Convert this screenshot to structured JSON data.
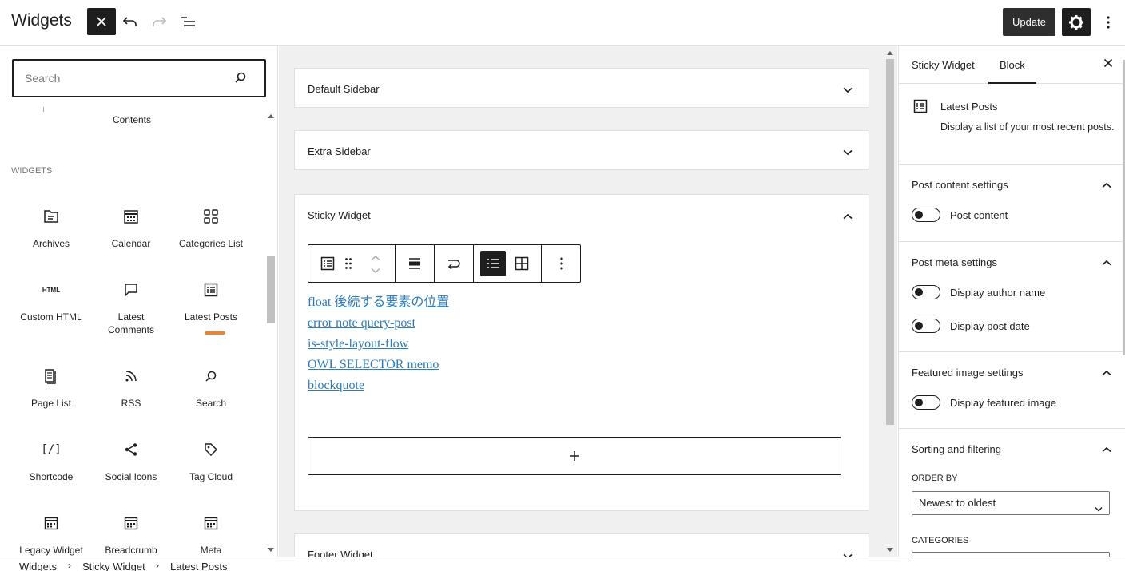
{
  "header": {
    "title": "Widgets",
    "update_label": "Update"
  },
  "inserter": {
    "search_placeholder": "Search",
    "contents_label": "Contents",
    "section_label": "WIDGETS",
    "blocks": [
      {
        "label": "Archives",
        "icon": "archive-icon"
      },
      {
        "label": "Calendar",
        "icon": "calendar-icon"
      },
      {
        "label": "Categories List",
        "icon": "categories-icon"
      },
      {
        "label": "Custom HTML",
        "icon": "html-icon",
        "icon_text": "HTML"
      },
      {
        "label": "Latest Comments",
        "icon": "comment-icon"
      },
      {
        "label": "Latest Posts",
        "icon": "post-list-icon"
      },
      {
        "label": "Page List",
        "icon": "pages-icon"
      },
      {
        "label": "RSS",
        "icon": "rss-icon"
      },
      {
        "label": "Search",
        "icon": "search-icon"
      },
      {
        "label": "Shortcode",
        "icon": "shortcode-icon",
        "icon_text": "[/]"
      },
      {
        "label": "Social Icons",
        "icon": "share-icon"
      },
      {
        "label": "Tag Cloud",
        "icon": "tag-icon"
      },
      {
        "label": "Legacy Widget",
        "icon": "widget-icon"
      },
      {
        "label": "Breadcrumb",
        "icon": "widget-icon"
      },
      {
        "label": "Meta",
        "icon": "widget-icon"
      }
    ],
    "highlight_color": "#f0822a"
  },
  "canvas": {
    "areas": [
      {
        "title": "Default Sidebar",
        "expanded": false
      },
      {
        "title": "Extra Sidebar",
        "expanded": false
      },
      {
        "title": "Sticky Widget",
        "expanded": true
      },
      {
        "title": "Footer Widget",
        "expanded": false
      }
    ],
    "posts": [
      "float 後続する要素の位置",
      "error note query-post",
      "is-style-layout-flow",
      "OWL SELECTOR memo",
      "blockquote"
    ],
    "link_color": "#2b7bb9"
  },
  "sidebar": {
    "tabs": [
      "Sticky Widget",
      "Block"
    ],
    "active_tab": "Block",
    "block_name": "Latest Posts",
    "block_description": "Display a list of your most recent posts.",
    "panels": {
      "content": {
        "title": "Post content settings",
        "toggles": [
          "Post content"
        ]
      },
      "meta": {
        "title": "Post meta settings",
        "toggles": [
          "Display author name",
          "Display post date"
        ]
      },
      "featured": {
        "title": "Featured image settings",
        "toggles": [
          "Display featured image"
        ]
      },
      "sorting": {
        "title": "Sorting and filtering",
        "order_by_label": "ORDER BY",
        "order_by_value": "Newest to oldest",
        "categories_label": "CATEGORIES"
      }
    }
  },
  "breadcrumb": [
    "Widgets",
    "Sticky Widget",
    "Latest Posts"
  ]
}
